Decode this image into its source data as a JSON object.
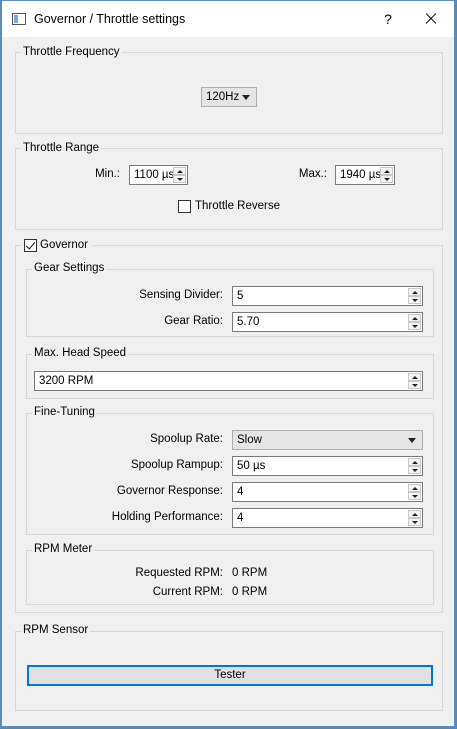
{
  "window": {
    "title": "Governor / Throttle settings",
    "help_glyph": "?"
  },
  "throttle_frequency": {
    "title": "Throttle Frequency",
    "value": "120Hz"
  },
  "throttle_range": {
    "title": "Throttle Range",
    "min_label": "Min.:",
    "min_value": "1100 µs",
    "max_label": "Max.:",
    "max_value": "1940 µs",
    "reverse_label": "Throttle Reverse",
    "reverse_checked": false
  },
  "governor": {
    "label": "Governor",
    "checked": true,
    "gear": {
      "title": "Gear Settings",
      "divider_label": "Sensing Divider:",
      "divider_value": "5",
      "ratio_label": "Gear Ratio:",
      "ratio_value": "5.70"
    },
    "head_speed": {
      "title": "Max. Head Speed",
      "value": "3200 RPM"
    },
    "fine_tuning": {
      "title": "Fine-Tuning",
      "spoolup_rate_label": "Spoolup Rate:",
      "spoolup_rate_value": "Slow",
      "spoolup_rampup_label": "Spoolup Rampup:",
      "spoolup_rampup_value": "50 µs",
      "response_label": "Governor Response:",
      "response_value": "4",
      "holding_label": "Holding Performance:",
      "holding_value": "4"
    },
    "rpm_meter": {
      "title": "RPM Meter",
      "requested_label": "Requested RPM:",
      "requested_value": "0 RPM",
      "current_label": "Current RPM:",
      "current_value": "0 RPM"
    }
  },
  "rpm_sensor": {
    "title": "RPM Sensor",
    "tester_label": "Tester"
  },
  "colors": {
    "accent": "#0078d7",
    "window_bg": "#f0f0f0",
    "frame": "#5f8fc2"
  }
}
